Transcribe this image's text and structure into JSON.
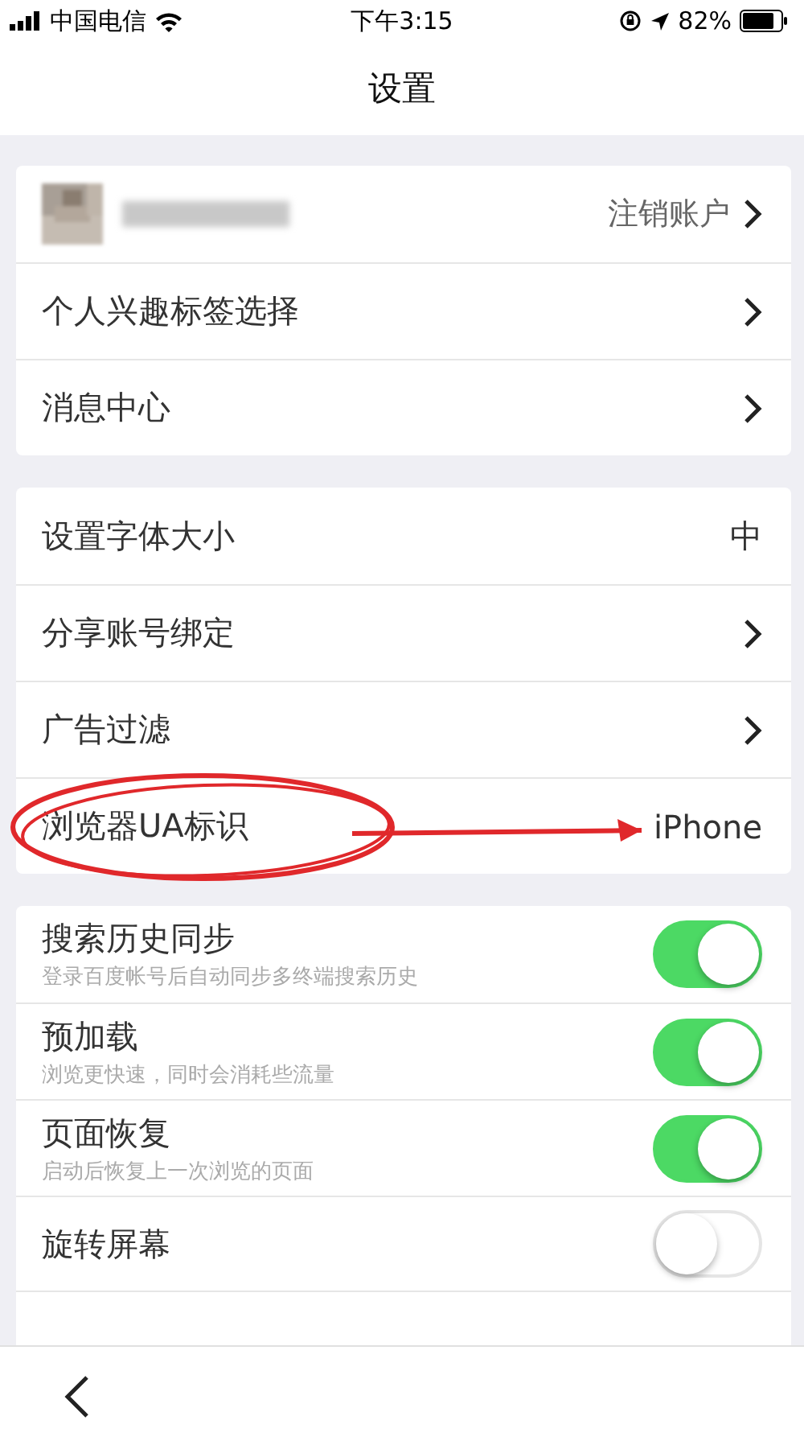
{
  "status_bar": {
    "carrier": "中国电信",
    "time": "下午3:15",
    "battery": "82%"
  },
  "nav": {
    "title": "设置"
  },
  "groups": [
    {
      "rows": [
        {
          "kind": "account",
          "action": "注销账户"
        },
        {
          "kind": "link",
          "label": "个人兴趣标签选择"
        },
        {
          "kind": "link",
          "label": "消息中心"
        }
      ]
    },
    {
      "rows": [
        {
          "kind": "value",
          "label": "设置字体大小",
          "value": "中"
        },
        {
          "kind": "link",
          "label": "分享账号绑定"
        },
        {
          "kind": "link",
          "label": "广告过滤"
        },
        {
          "kind": "value",
          "label": "浏览器UA标识",
          "value": "iPhone"
        }
      ]
    },
    {
      "rows": [
        {
          "kind": "toggle",
          "label": "搜索历史同步",
          "subtitle": "登录百度帐号后自动同步多终端搜索历史",
          "on": true
        },
        {
          "kind": "toggle",
          "label": "预加载",
          "subtitle": "浏览更快速，同时会消耗些流量",
          "on": true
        },
        {
          "kind": "toggle",
          "label": "页面恢复",
          "subtitle": "启动后恢复上一次浏览的页面",
          "on": true
        },
        {
          "kind": "toggle",
          "label": "旋转屏幕",
          "on": false
        }
      ]
    }
  ]
}
